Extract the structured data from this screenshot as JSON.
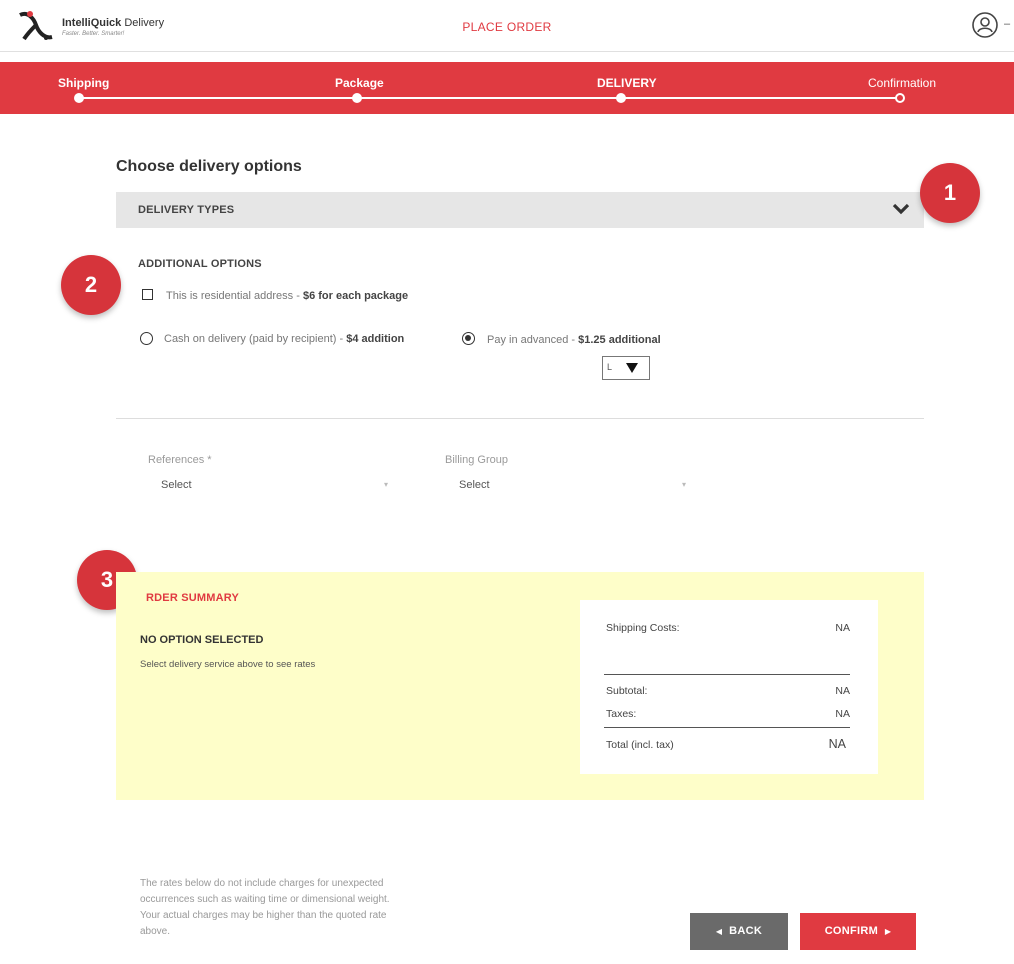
{
  "header": {
    "logo_name_bold": "IntelliQuick",
    "logo_name_rest": " Delivery",
    "logo_tagline": "Faster. Better. Smarter!",
    "title": "PLACE ORDER"
  },
  "steps": [
    {
      "label": "Shipping",
      "state": "done"
    },
    {
      "label": "Package",
      "state": "done"
    },
    {
      "label": "DELIVERY",
      "state": "current"
    },
    {
      "label": "Confirmation",
      "state": "pending"
    }
  ],
  "main": {
    "section_title": "Choose delivery options",
    "delivery_types_label": "DELIVERY TYPES",
    "additional_options_title": "ADDITIONAL OPTIONS",
    "residential_text": "This is residential address - ",
    "residential_fee": "$6 for each package",
    "cod_text": "Cash on delivery (paid by recipient) - ",
    "cod_fee": "$4 addition",
    "advance_text": "Pay in advanced - ",
    "advance_fee": "$1.25 additional",
    "mini_select_value": "L",
    "references_label": "References *",
    "references_value": "Select",
    "billing_label": "Billing Group",
    "billing_value": "Select"
  },
  "callouts": [
    "1",
    "2",
    "3"
  ],
  "summary": {
    "title": "RDER SUMMARY",
    "no_option": "NO OPTION SELECTED",
    "no_option_sub": "Select delivery service above to see rates",
    "shipping_label": "Shipping Costs:",
    "shipping_value": "NA",
    "subtotal_label": "Subtotal:",
    "subtotal_value": "NA",
    "taxes_label": "Taxes:",
    "taxes_value": "NA",
    "total_label": "Total (incl. tax)",
    "total_value": "NA"
  },
  "footer": {
    "disclaimer": "The rates below do not include charges for unexpected occurrences such as waiting time or dimensional weight. Your actual charges may be higher than the quoted rate above.",
    "back_label": "BACK",
    "confirm_label": "CONFIRM"
  },
  "colors": {
    "brand_red": "#e03a41",
    "summary_bg": "#fefec9",
    "back_gray": "#6a6a6a"
  }
}
